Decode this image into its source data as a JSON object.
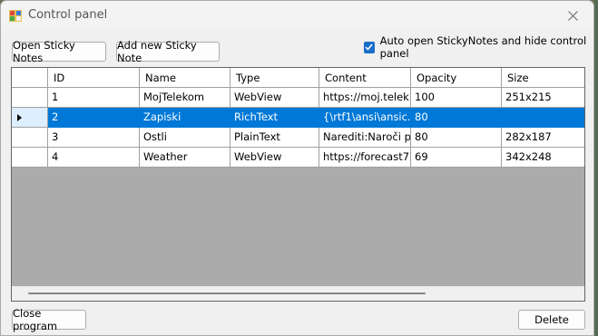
{
  "window": {
    "title": "Control panel",
    "close_icon": "close-icon",
    "app_icon": "control-panel-app-icon"
  },
  "toolbar": {
    "open_label": "Open Sticky Notes",
    "add_label": "Add new Sticky Note",
    "auto_open_label": "Auto open StickyNotes and hide control panel",
    "auto_open_checked": true
  },
  "grid": {
    "columns": [
      "ID",
      "Name",
      "Type",
      "Content",
      "Opacity",
      "Size"
    ],
    "rows": [
      {
        "id": "1",
        "name": "MojTelekom",
        "type": "WebView",
        "content": "https://moj.telek...",
        "opacity": "100",
        "size": "251x215"
      },
      {
        "id": "2",
        "name": "Zapiski",
        "type": "RichText",
        "content": "{\\rtf1\\ansi\\ansic...",
        "opacity": "80",
        "size": ""
      },
      {
        "id": "3",
        "name": "Ostli",
        "type": "PlainText",
        "content": "Narediti:Naroči pr...",
        "opacity": "80",
        "size": "282x187"
      },
      {
        "id": "4",
        "name": "Weather",
        "type": "WebView",
        "content": "https://forecast7....",
        "opacity": "69",
        "size": "342x248"
      }
    ],
    "selected_row": 1
  },
  "footer": {
    "close_label": "Close program",
    "delete_label": "Delete"
  },
  "colors": {
    "selection": "#0078d7",
    "grid_background": "#ababab",
    "window_background": "#f0f0f0",
    "checkbox_accent": "#1a6ec9"
  }
}
